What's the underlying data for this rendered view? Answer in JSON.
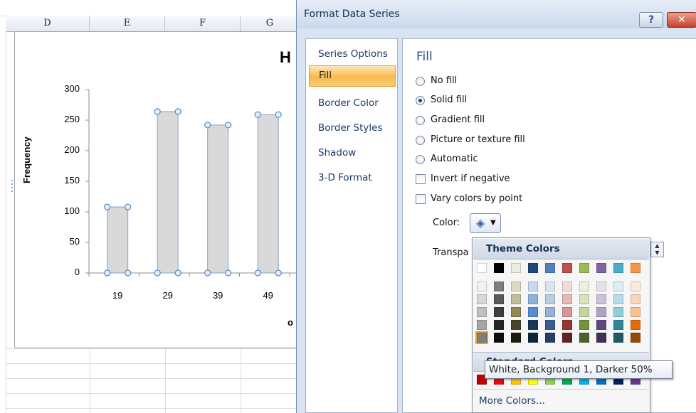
{
  "sheet": {
    "columns": [
      "D",
      "E",
      "F",
      "G"
    ]
  },
  "chart": {
    "title_fragment": "H",
    "ylabel": "Frequency",
    "xlabel_fragment": "o",
    "bar_color": "#d9d9d9",
    "bar_border": "#8ba2bd"
  },
  "chart_data": {
    "type": "bar",
    "title": "H",
    "xlabel": "o",
    "ylabel": "Frequency",
    "categories": [
      "19",
      "29",
      "39",
      "49"
    ],
    "values": [
      108,
      264,
      242,
      259
    ],
    "ylim": [
      0,
      300
    ],
    "yticks": [
      "0",
      "50",
      "100",
      "150",
      "200",
      "250",
      "300"
    ],
    "grid": false
  },
  "dialog": {
    "title": "Format Data Series",
    "help_label": "?",
    "close_label": "✕",
    "nav": [
      {
        "label": "Series Options",
        "selected": false
      },
      {
        "label": "Fill",
        "selected": true
      },
      {
        "label": "Border Color",
        "selected": false
      },
      {
        "label": "Border Styles",
        "selected": false
      },
      {
        "label": "Shadow",
        "selected": false
      },
      {
        "label": "3-D Format",
        "selected": false
      }
    ],
    "heading": "Fill",
    "radio_options": [
      {
        "label": "No fill",
        "checked": false
      },
      {
        "label": "Solid fill",
        "checked": true
      },
      {
        "label": "Gradient fill",
        "checked": false
      },
      {
        "label": "Picture or texture fill",
        "checked": false
      },
      {
        "label": "Automatic",
        "checked": false
      }
    ],
    "checkbox_options": [
      {
        "label": "Invert if negative",
        "checked": false
      },
      {
        "label": "Vary colors by point",
        "checked": false
      }
    ],
    "color_label": "Color:",
    "transparency_label": "Transpa",
    "color_icon": "paint-bucket-icon"
  },
  "color_picker": {
    "theme_title": "Theme Colors",
    "standard_title": "Standard Colors",
    "more_colors": "More Colors...",
    "theme_base": [
      "#ffffff",
      "#000000",
      "#eeece1",
      "#1f497d",
      "#4f81bd",
      "#c0504d",
      "#9bbb59",
      "#8064a2",
      "#4bacc6",
      "#f79646"
    ],
    "theme_shades": [
      [
        "#f2f2f2",
        "#d8d8d8",
        "#bfbfbf",
        "#a5a5a5",
        "#7f7f7f"
      ],
      [
        "#7f7f7f",
        "#595959",
        "#3f3f3f",
        "#262626",
        "#0c0c0c"
      ],
      [
        "#ddd9c3",
        "#c4bd97",
        "#938953",
        "#494429",
        "#1d1b10"
      ],
      [
        "#c6d9f0",
        "#8db3e2",
        "#548dd4",
        "#17365d",
        "#0f243e"
      ],
      [
        "#dbe5f1",
        "#b8cce4",
        "#95b3d7",
        "#366092",
        "#244061"
      ],
      [
        "#f2dcdb",
        "#e5b9b7",
        "#d99694",
        "#953734",
        "#632423"
      ],
      [
        "#ebf1dd",
        "#d7e3bc",
        "#c3d69b",
        "#76923c",
        "#4f6128"
      ],
      [
        "#e5e0ec",
        "#ccc1d9",
        "#b2a2c7",
        "#5f497a",
        "#3f3151"
      ],
      [
        "#dbeef3",
        "#b7dde8",
        "#92cddc",
        "#31859b",
        "#205867"
      ],
      [
        "#fdeada",
        "#fbd5b5",
        "#fac08f",
        "#e36c09",
        "#974806"
      ]
    ],
    "standard": [
      "#c00000",
      "#ff0000",
      "#ffc000",
      "#ffff00",
      "#92d050",
      "#00b050",
      "#00b0f0",
      "#0070c0",
      "#002060",
      "#7030a0"
    ],
    "highlight": "#7f7f7f"
  },
  "tooltip": "White, Background 1, Darker 50%"
}
